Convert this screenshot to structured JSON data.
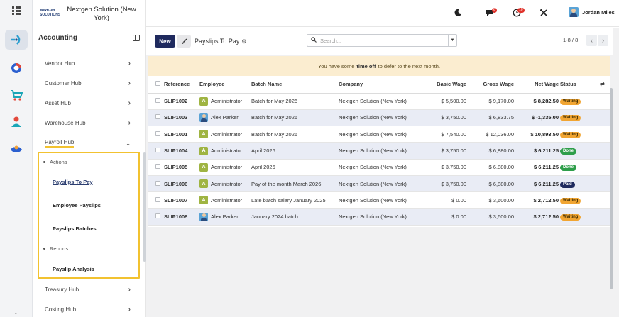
{
  "app": {
    "company_logo_text": "NextGen SOLUTIONS",
    "company_name": "Nextgen Solution (New York)",
    "module_title": "Accounting"
  },
  "rail": {
    "icons": [
      "apps-grid-icon",
      "accounting-icon",
      "hub-icon",
      "cart-icon",
      "people-icon",
      "handshake-icon"
    ]
  },
  "sidebar": {
    "items": [
      {
        "label": "Vendor Hub"
      },
      {
        "label": "Customer Hub"
      },
      {
        "label": "Asset Hub"
      },
      {
        "label": "Warehouse Hub"
      },
      {
        "label": "Payroll Hub"
      },
      {
        "label": "Treasury Hub"
      },
      {
        "label": "Costing Hub"
      }
    ],
    "payroll_sub": {
      "actions_label": "Actions",
      "reports_label": "Reports",
      "links": [
        "Payslips To Pay",
        "Employee Payslips",
        "Payslips Batches"
      ],
      "report_links": [
        "Payslip Analysis"
      ]
    }
  },
  "topbar": {
    "chat_count": "6",
    "activity_count": "10",
    "user_name": "Jordan Miles"
  },
  "toolbar": {
    "new_label": "New",
    "breadcrumb": "Payslips To Pay",
    "search_placeholder": "Search...",
    "pager": "1-8 / 8"
  },
  "notice": {
    "before": "You have some",
    "bold": "time off",
    "after": "to defer to the next month."
  },
  "table": {
    "headers": [
      "Reference",
      "Employee",
      "Batch Name",
      "Company",
      "Basic Wage",
      "Gross Wage",
      "Net Wage",
      "Status"
    ],
    "rows": [
      {
        "ref": "SLIP1002",
        "emp": "Administrator",
        "av": "A",
        "batch": "Batch for May 2026",
        "company": "Nextgen Solution (New York)",
        "basic": "$ 5,500.00",
        "gross": "$ 9,170.00",
        "net": "$ 8,282.50",
        "status": "Waiting"
      },
      {
        "ref": "SLIP1003",
        "emp": "Alex Parker",
        "av": "",
        "batch": "Batch for May 2026",
        "company": "Nextgen Solution (New York)",
        "basic": "$ 3,750.00",
        "gross": "$ 6,833.75",
        "net": "$ -1,335.00",
        "status": "Waiting"
      },
      {
        "ref": "SLIP1001",
        "emp": "Administrator",
        "av": "A",
        "batch": "Batch for May 2026",
        "company": "Nextgen Solution (New York)",
        "basic": "$ 7,540.00",
        "gross": "$ 12,036.00",
        "net": "$ 10,893.50",
        "status": "Waiting"
      },
      {
        "ref": "SLIP1004",
        "emp": "Administrator",
        "av": "A",
        "batch": "April 2026",
        "company": "Nextgen Solution (New York)",
        "basic": "$ 3,750.00",
        "gross": "$ 6,880.00",
        "net": "$ 6,211.25",
        "status": "Done"
      },
      {
        "ref": "SLIP1005",
        "emp": "Administrator",
        "av": "A",
        "batch": "April 2026",
        "company": "Nextgen Solution (New York)",
        "basic": "$ 3,750.00",
        "gross": "$ 6,880.00",
        "net": "$ 6,211.25",
        "status": "Done"
      },
      {
        "ref": "SLIP1006",
        "emp": "Administrator",
        "av": "A",
        "batch": "Pay of the month March 2026",
        "company": "Nextgen Solution (New York)",
        "basic": "$ 3,750.00",
        "gross": "$ 6,880.00",
        "net": "$ 6,211.25",
        "status": "Paid"
      },
      {
        "ref": "SLIP1007",
        "emp": "Administrator",
        "av": "A",
        "batch": "Late batch salary January 2025",
        "company": "Nextgen Solution (New York)",
        "basic": "$ 0.00",
        "gross": "$ 3,600.00",
        "net": "$ 2,712.50",
        "status": "Waiting"
      },
      {
        "ref": "SLIP1008",
        "emp": "Alex Parker",
        "av": "",
        "batch": "January 2024 batch",
        "company": "Nextgen Solution (New York)",
        "basic": "$ 0.00",
        "gross": "$ 3,600.00",
        "net": "$ 2,712.50",
        "status": "Waiting"
      }
    ]
  },
  "colors": {
    "primary": "#1f2a5e",
    "highlight": "#f2c230",
    "waiting": "#f1a532",
    "done": "#2e9e4a",
    "notice_bg": "#fbedd0"
  }
}
